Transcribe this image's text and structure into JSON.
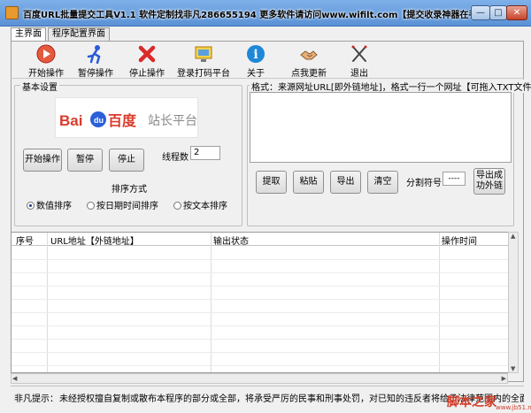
{
  "window": {
    "title": "百度URL批量提交工具V1.1  软件定制找非凡286655194 更多软件请访问www.wifilt.com【提交收录神器在手】",
    "minimize_glyph": "—",
    "maximize_glyph": "□",
    "close_glyph": "✕"
  },
  "tabs": [
    {
      "label": "主界面",
      "active": true
    },
    {
      "label": "程序配置界面",
      "active": false
    }
  ],
  "toolbar": {
    "items": [
      {
        "label": "开始操作",
        "icon": "start-circle-icon",
        "color": "#d9422a"
      },
      {
        "label": "暂停操作",
        "icon": "runner-icon",
        "color": "#2a5bd9"
      },
      {
        "label": "停止操作",
        "icon": "red-x-icon",
        "color": "#d92a2a"
      },
      {
        "label": "登录打码平台",
        "icon": "login-monitor-icon",
        "color": "#e2a400"
      },
      {
        "label": "关于",
        "icon": "info-icon",
        "color": "#1e87d8"
      },
      {
        "label": "点我更新",
        "icon": "update-handshake-icon",
        "color": "#a66a2a"
      },
      {
        "label": "退出",
        "icon": "exit-cross-icon",
        "color": "#5a5a5a"
      }
    ]
  },
  "basic_settings": {
    "legend": "基本设置",
    "logo_brand": "Baidu百度",
    "logo_suffix": "站长平台",
    "start_label": "开始操作",
    "pause_label": "暂停",
    "stop_label": "停止",
    "threads_label": "线程数",
    "threads_value": "2",
    "sort_label": "排序方式",
    "sort_options": [
      {
        "label": "数值排序",
        "selected": true
      },
      {
        "label": "按日期时间排序",
        "selected": false
      },
      {
        "label": "按文本排序",
        "selected": false
      }
    ]
  },
  "format_box": {
    "legend": "格式：来源网址URL[即外链地址]，格式一行一个网址【可拖入TXT文件】",
    "textarea_value": "",
    "extract_label": "提取",
    "paste_label": "粘贴",
    "export_label": "导出",
    "clear_label": "清空",
    "separator_label": "分割符号",
    "separator_value": "----",
    "export_success_label_1": "导出成",
    "export_success_label_2": "功外链"
  },
  "table": {
    "columns": [
      "序号",
      "URL地址【外链地址】",
      "输出状态",
      "操作时间"
    ],
    "rows": []
  },
  "status": {
    "label": "非凡提示：",
    "text": "未经授权擅自复制或散布本程序的部分或全部，将承受严厉的民事和刑事处罚，对已知的违反者将给予法律范围内的全面制裁"
  },
  "watermark": {
    "text": "脚本之家",
    "sub": "www.jb51.net"
  }
}
